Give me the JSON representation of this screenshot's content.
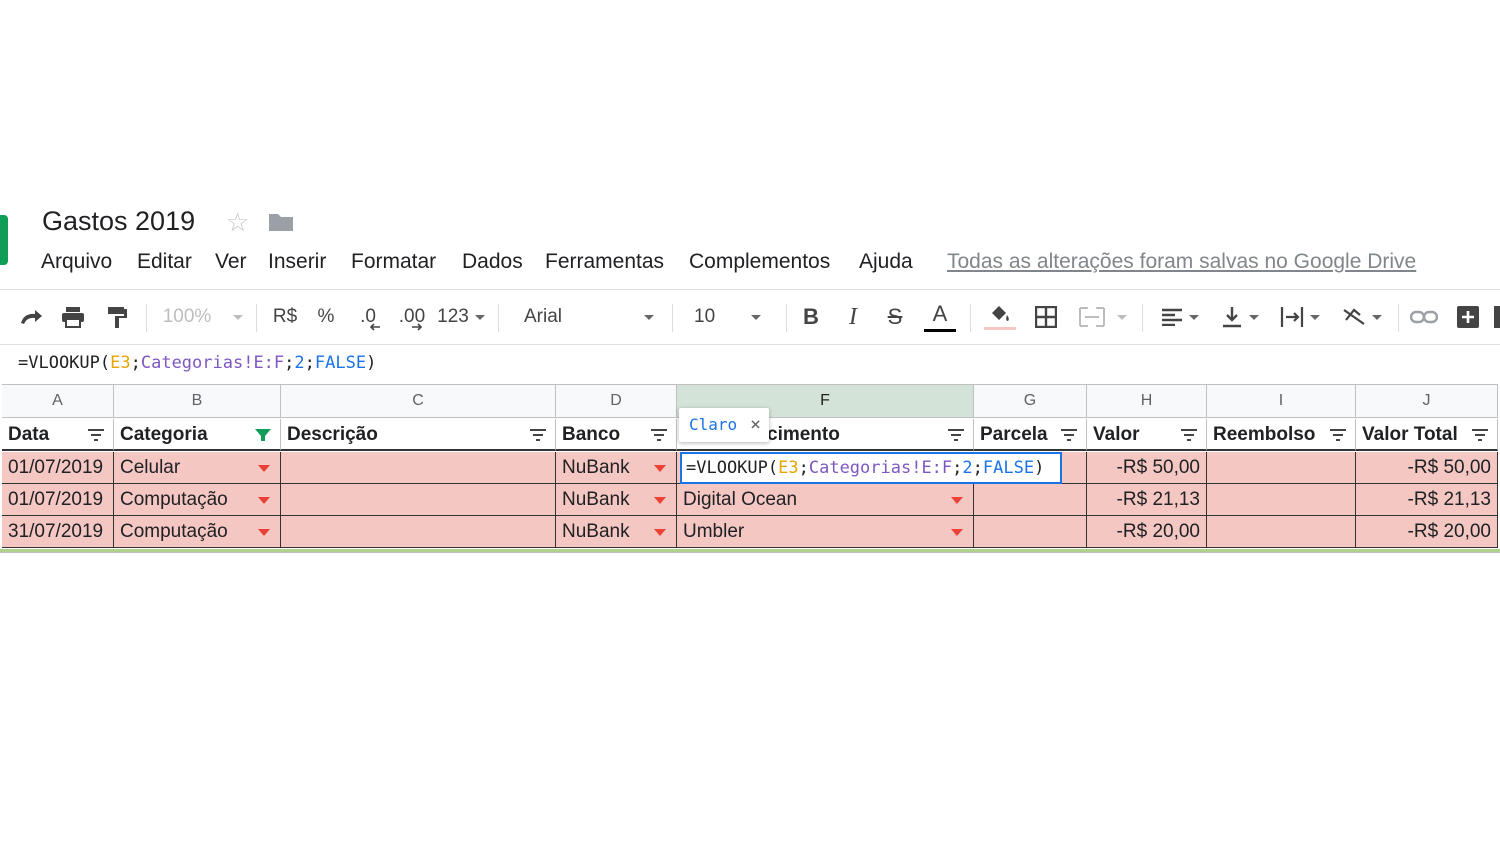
{
  "app": {
    "title": "Gastos 2019",
    "logo_color": "#0f9d58",
    "star_icon": "star-outline-icon",
    "folder_icon": "folder-icon"
  },
  "menu": [
    "Arquivo",
    "Editar",
    "Ver",
    "Inserir",
    "Formatar",
    "Dados",
    "Ferramentas",
    "Complementos",
    "Ajuda"
  ],
  "save_status": "Todas as alterações foram salvas no Google Drive",
  "toolbar": {
    "zoom": "100%",
    "currency": "R$",
    "percent": "%",
    "decrease_decimals": ".0",
    "increase_decimals": ".00",
    "more_formats": "123",
    "font": "Arial",
    "font_size": "10",
    "bold": "B",
    "italic": "I",
    "strikethrough": "S",
    "text_color": "A"
  },
  "formula_bar": {
    "prefix": "=VLOOKUP(",
    "ref": "E3",
    "sep1": ";",
    "sheet_range": "Categorias!E:F",
    "sep2": ";",
    "index": "2",
    "sep3": ";",
    "flag": "FALSE",
    "suffix": ")"
  },
  "columns": [
    "A",
    "B",
    "C",
    "D",
    "F",
    "G",
    "H",
    "I",
    "J"
  ],
  "headers": [
    "Data",
    "Categoria",
    "Descrição",
    "Banco",
    "cimento",
    "Parcela",
    "Valor",
    "Reembolso",
    "Valor Total"
  ],
  "rows": [
    [
      "01/07/2019",
      "Celular",
      "",
      "NuBank",
      "",
      "",
      "-R$ 50,00",
      "",
      "-R$ 50,00"
    ],
    [
      "01/07/2019",
      "Computação",
      "",
      "NuBank",
      "Digital Ocean",
      "",
      "-R$ 21,13",
      "",
      "-R$ 21,13"
    ],
    [
      "31/07/2019",
      "Computação",
      "",
      "NuBank",
      "Umbler",
      "",
      "-R$ 20,00",
      "",
      "-R$ 20,00"
    ]
  ],
  "autocomplete": {
    "label": "Claro",
    "close": "×"
  },
  "colors": {
    "row_fill": "#f4c7c3",
    "dropdown_arrow": "#ea4335",
    "active_filter": "#0f9d58",
    "selection": "#1a73e8"
  }
}
